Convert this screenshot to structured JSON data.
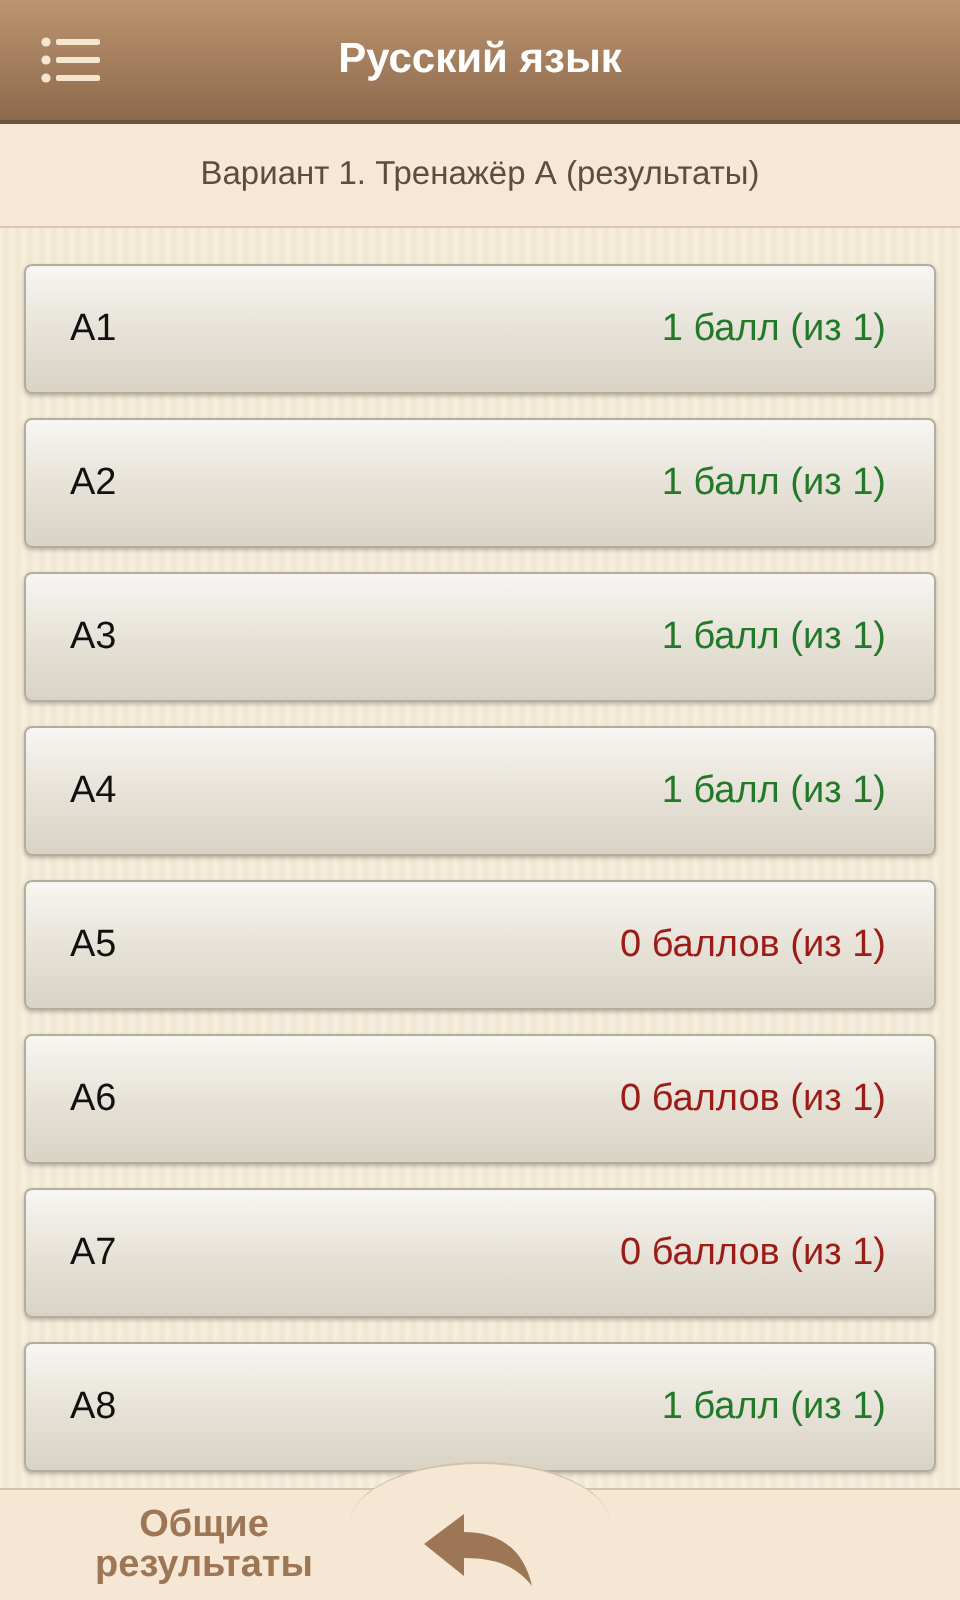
{
  "header": {
    "title": "Русский язык"
  },
  "subtitle": "Вариант 1. Тренажёр А (результаты)",
  "items": [
    {
      "label": "А1",
      "score": "1 балл (из 1)",
      "color": "#23792a"
    },
    {
      "label": "А2",
      "score": "1 балл (из 1)",
      "color": "#23792a"
    },
    {
      "label": "А3",
      "score": "1 балл (из 1)",
      "color": "#23792a"
    },
    {
      "label": "А4",
      "score": "1 балл (из 1)",
      "color": "#23792a"
    },
    {
      "label": "А5",
      "score": "0 баллов (из 1)",
      "color": "#9b1b16"
    },
    {
      "label": "А6",
      "score": "0 баллов (из 1)",
      "color": "#9b1b16"
    },
    {
      "label": "А7",
      "score": "0 баллов (из 1)",
      "color": "#9b1b16"
    },
    {
      "label": "А8",
      "score": "1 балл (из 1)",
      "color": "#23792a"
    }
  ],
  "footer": {
    "results_button": "Общие результаты"
  }
}
